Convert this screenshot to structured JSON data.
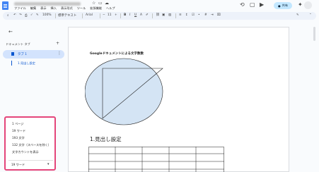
{
  "menu": [
    "ファイル",
    "編集",
    "表示",
    "挿入",
    "表示形式",
    "ツール",
    "拡張機能",
    "ヘルプ"
  ],
  "toolbar": {
    "zoom": "100%",
    "style": "標準テキスト",
    "font": "Arial",
    "font_size": "11"
  },
  "share": {
    "label": "共有"
  },
  "sidebar": {
    "tabs_heading": "ドキュメント タブ",
    "add_tab": "+",
    "active_tab": "タブ 1",
    "outline_item": "1.見出し設定"
  },
  "word_count": {
    "pages": "1 ページ",
    "words": "19 ワード",
    "chars": "193 文字",
    "chars_no_space": "132 文字（スペースを除く）",
    "show_count": "文字カウントを表示",
    "selector": "19 ワード"
  },
  "document": {
    "small_title": "Googleドキュメントによる文字数数",
    "heading": "1.見出し設定"
  },
  "colors": {
    "accent": "#0b57d0",
    "highlight_border": "#e4457a",
    "ellipse_fill": "#d4e4f4",
    "share_bg": "#c2e7ff"
  }
}
